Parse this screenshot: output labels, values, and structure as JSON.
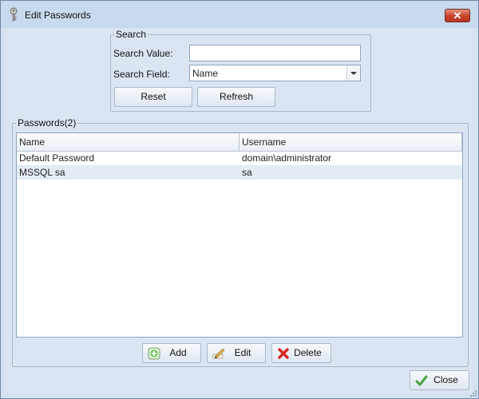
{
  "window": {
    "title": "Edit Passwords",
    "close_symbol": "✕"
  },
  "search": {
    "legend": "Search",
    "value_label": "Search Value:",
    "value_input": "",
    "field_label": "Search Field:",
    "field_selected": "Name",
    "reset_label": "Reset",
    "refresh_label": "Refresh"
  },
  "passwords": {
    "legend": "Passwords(2)",
    "columns": [
      "Name",
      "Username"
    ],
    "rows": [
      {
        "name": "Default Password",
        "username": "domain\\administrator"
      },
      {
        "name": "MSSQL sa",
        "username": "sa"
      }
    ]
  },
  "actions": {
    "add_label": "Add",
    "edit_label": "Edit",
    "delete_label": "Delete"
  },
  "footer": {
    "close_label": "Close"
  },
  "colors": {
    "title_bg": "#c9d9ee",
    "client_bg": "#dbe5f2",
    "close_btn": "#c8422a",
    "alt_row": "#e3ebf5"
  },
  "icons": {
    "app": "key-icon",
    "add": "add-plus-icon",
    "edit": "pencil-icon",
    "delete": "red-x-icon",
    "close": "green-check-icon"
  }
}
